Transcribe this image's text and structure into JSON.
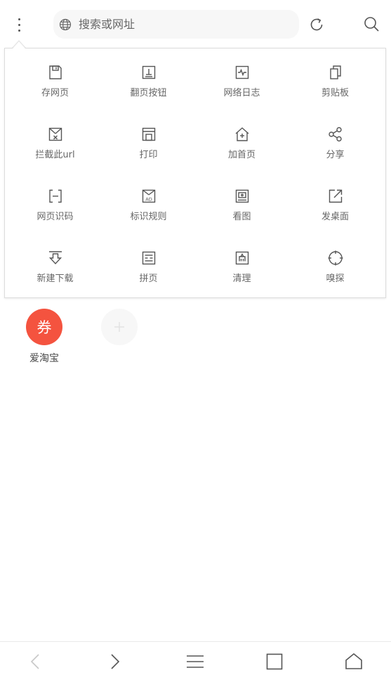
{
  "toolbar": {
    "search_placeholder": "搜索或网址",
    "menu_icon": "more-vertical-icon",
    "globe_icon": "globe-icon",
    "refresh_icon": "refresh-icon",
    "search_icon": "search-icon"
  },
  "menu": {
    "items": [
      {
        "label": "存网页",
        "icon": "save-page-icon"
      },
      {
        "label": "翻页按钮",
        "icon": "page-turn-button-icon"
      },
      {
        "label": "网络日志",
        "icon": "network-log-icon"
      },
      {
        "label": "剪贴板",
        "icon": "clipboard-icon"
      },
      {
        "label": "拦截此url",
        "icon": "block-url-icon"
      },
      {
        "label": "打印",
        "icon": "print-icon"
      },
      {
        "label": "加首页",
        "icon": "add-home-icon"
      },
      {
        "label": "分享",
        "icon": "share-icon"
      },
      {
        "label": "网页识码",
        "icon": "scan-code-icon"
      },
      {
        "label": "标识规则",
        "icon": "ad-rule-icon"
      },
      {
        "label": "看图",
        "icon": "view-image-icon"
      },
      {
        "label": "发桌面",
        "icon": "send-desktop-icon"
      },
      {
        "label": "新建下载",
        "icon": "download-icon"
      },
      {
        "label": "拼页",
        "icon": "merge-page-icon"
      },
      {
        "label": "清理",
        "icon": "clean-icon"
      },
      {
        "label": "嗅探",
        "icon": "sniff-icon"
      }
    ]
  },
  "shortcuts": [
    {
      "label": "爱淘宝",
      "glyph": "券",
      "color": "#f4533f"
    },
    {
      "label": "",
      "glyph": "+",
      "color": "#f7f7f7"
    }
  ],
  "bottom_nav": {
    "back_icon": "back-icon",
    "forward_icon": "forward-icon",
    "menu_icon": "menu-icon",
    "tabs_icon": "tabs-icon",
    "home_icon": "home-icon"
  }
}
